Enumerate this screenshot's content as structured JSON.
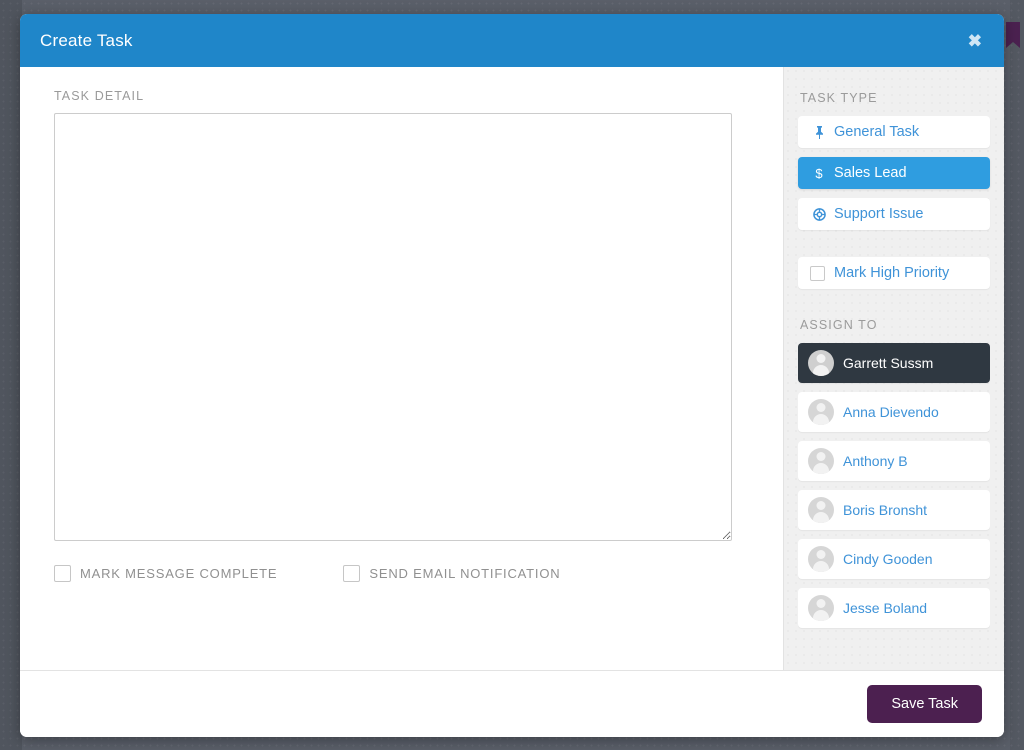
{
  "background": {
    "glyph_icon": "bookmark-icon"
  },
  "modal": {
    "title": "Create Task",
    "close_label": "✖",
    "detail": {
      "section_label": "TASK DETAIL",
      "value": "",
      "placeholder": ""
    },
    "options": [
      {
        "label": "MARK MESSAGE COMPLETE",
        "checked": false,
        "name": "mark-message-complete"
      },
      {
        "label": "SEND EMAIL NOTIFICATION",
        "checked": false,
        "name": "send-email-notification"
      }
    ],
    "sidebar": {
      "task_type_label": "TASK TYPE",
      "task_types": [
        {
          "label": "General Task",
          "icon": "pin-icon",
          "glyph": "📌",
          "active": false
        },
        {
          "label": "Sales Lead",
          "icon": "dollar-icon",
          "glyph": "$",
          "active": true
        },
        {
          "label": "Support Issue",
          "icon": "lifebuoy-icon",
          "glyph": "☉",
          "active": false
        }
      ],
      "priority": {
        "label": "Mark High Priority",
        "checked": false
      },
      "assign_to_label": "ASSIGN TO",
      "assignees": [
        {
          "name": "Garrett Sussm",
          "selected": true
        },
        {
          "name": "Anna Dievendo",
          "selected": false
        },
        {
          "name": "Anthony B",
          "selected": false
        },
        {
          "name": "Boris Bronsht",
          "selected": false
        },
        {
          "name": "Cindy Gooden",
          "selected": false
        },
        {
          "name": "Jesse Boland",
          "selected": false
        }
      ]
    },
    "footer": {
      "save_label": "Save Task"
    }
  },
  "colors": {
    "header_blue": "#1f86c9",
    "accent_blue": "#2f9de0",
    "link_blue": "#3f93d8",
    "save_purple": "#4c2050",
    "selected_dark": "#2f3841",
    "page_bg": "#5a5f69"
  }
}
